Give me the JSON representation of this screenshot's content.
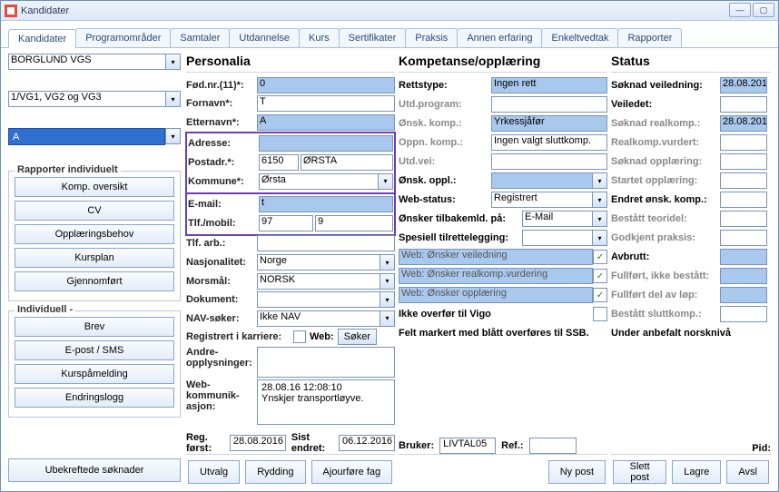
{
  "window": {
    "title": "Kandidater"
  },
  "tabs": [
    "Kandidater",
    "Programområder",
    "Samtaler",
    "Utdannelse",
    "Kurs",
    "Sertifikater",
    "Praksis",
    "Annen erfaring",
    "Enkeltvedtak",
    "Rapporter"
  ],
  "active_tab": 0,
  "left": {
    "school": "BORGLUND VGS",
    "level": "1/VG1, VG2 og VG3",
    "selected_row": "A",
    "group1_title": "Rapporter individuelt",
    "group1_btns": [
      "Komp. oversikt",
      "CV",
      "Opplæringsbehov",
      "Kursplan",
      "Gjennomført"
    ],
    "group2_title": "Individuell -",
    "group2_btns": [
      "Brev",
      "E-post / SMS",
      "Kurspåmelding",
      "Endringslogg"
    ],
    "ubekreftede": "Ubekreftede søknader"
  },
  "personalia": {
    "header": "Personalia",
    "fod_lbl": "Fød.nr.(11)*:",
    "fod_val": "0",
    "fornavn_lbl": "Fornavn*:",
    "fornavn_val": "T",
    "etternavn_lbl": "Etternavn*:",
    "etternavn_val": "A",
    "adresse_lbl": "Adresse:",
    "adresse_val": "",
    "postadr_lbl": "Postadr.*:",
    "postadr_nr": "6150",
    "postadr_sted": "ØRSTA",
    "kommune_lbl": "Kommune*:",
    "kommune_val": "Ørsta",
    "email_lbl": "E-mail:",
    "email_val": "t",
    "tlf_lbl": "Tlf./mobil:",
    "tlf1": "97",
    "tlf2": "9",
    "tlfarb_lbl": "Tlf. arb.:",
    "tlfarb_val": "",
    "nasj_lbl": "Nasjonalitet:",
    "nasj_val": "Norge",
    "morsmal_lbl": "Morsmål:",
    "morsmal_val": "NORSK",
    "dokument_lbl": "Dokument:",
    "dokument_val": "",
    "nav_lbl": "NAV-søker:",
    "nav_val": "Ikke NAV",
    "reg_lbl": "Registrert i karriere:",
    "web_lbl": "Web:",
    "web_btn": "Søker",
    "andre_lbl": "Andre-\nopplysninger:",
    "webkom_lbl": "Web-\nkommunik-\nasjon:",
    "webkom_txt": "28.08.16 12:08:10\nYnskjer transportløyve."
  },
  "kompetanse": {
    "header": "Kompetanse/opplæring",
    "rows": [
      {
        "lbl": "Rettstype:",
        "val": "Ingen rett",
        "sel": true,
        "gray": false
      },
      {
        "lbl": "Utd.program:",
        "val": "",
        "sel": false,
        "gray": true
      },
      {
        "lbl": "Ønsk. komp.:",
        "val": "Yrkessjåfør",
        "sel": true,
        "gray": true
      },
      {
        "lbl": "Oppn. komp.:",
        "val": "Ingen valgt sluttkomp.",
        "sel": false,
        "gray": true
      },
      {
        "lbl": "Utd.vei:",
        "val": "",
        "sel": false,
        "gray": true
      },
      {
        "lbl": "Ønsk. oppl.:",
        "val": "",
        "sel": true,
        "dd": true,
        "gray": false
      },
      {
        "lbl": "Web-status:",
        "val": "Registrert",
        "sel": false,
        "dd": true,
        "gray": false
      },
      {
        "lbl": "Ønsker tilbakemld. på:",
        "val": "E-Mail",
        "sel": false,
        "dd": true,
        "wide": true,
        "gray": false
      },
      {
        "lbl": "Spesiell tilrettelegging:",
        "val": "",
        "sel": false,
        "dd": true,
        "wide": true,
        "gray": false
      }
    ],
    "web_checks": [
      {
        "lbl": "Web: Ønsker veiledning",
        "checked": true
      },
      {
        "lbl": "Web: Ønsker realkomp.vurdering",
        "checked": true
      },
      {
        "lbl": "Web: Ønsker opplæring",
        "checked": true
      }
    ],
    "ikke_overfor": {
      "lbl": "Ikke overfør til Vigo",
      "checked": false
    },
    "felt_txt": "Felt markert med blått overføres til SSB."
  },
  "status": {
    "header": "Status",
    "rows": [
      {
        "lbl": "Søknad veiledning:",
        "val": "28.08.201",
        "sel": true
      },
      {
        "lbl": "Veiledet:",
        "val": "",
        "sel": false
      },
      {
        "lbl": "Søknad realkomp.:",
        "val": "28.08.201",
        "sel": true,
        "gray": true
      },
      {
        "lbl": "Realkomp.vurdert:",
        "val": "",
        "sel": false,
        "gray": true
      },
      {
        "lbl": "Søknad opplæring:",
        "val": "",
        "sel": false,
        "gray": true
      },
      {
        "lbl": "Startet opplæring:",
        "val": "",
        "sel": false,
        "gray": true
      },
      {
        "lbl": "Endret ønsk. komp.:",
        "val": "",
        "sel": false
      },
      {
        "lbl": "Bestått teoridel:",
        "val": "",
        "sel": false,
        "gray": true
      },
      {
        "lbl": "Godkjent praksis:",
        "val": "",
        "sel": false,
        "gray": true
      },
      {
        "lbl": "Avbrutt:",
        "val": "",
        "sel": true
      },
      {
        "lbl": "Fullført, ikke bestått:",
        "val": "",
        "sel": true,
        "gray": true
      },
      {
        "lbl": "Fullført del av løp:",
        "val": "",
        "sel": true,
        "gray": true
      },
      {
        "lbl": "Bestått sluttkomp.:",
        "val": "",
        "sel": false,
        "gray": true
      }
    ],
    "under_norsk": "Under anbefalt norsknivå"
  },
  "regline": {
    "regforst_lbl": "Reg. først:",
    "regforst_val": "28.08.2016",
    "sistendret_lbl": "Sist endret:",
    "sistendret_val": "06.12.2016",
    "bruker_lbl": "Bruker:",
    "bruker_val": "LIVTAL05",
    "ref_lbl": "Ref.:",
    "ref_val": "",
    "pid_lbl": "Pid:"
  },
  "footer": {
    "btns": [
      "Utvalg",
      "Rydding",
      "Ajourføre fag"
    ],
    "right_btns": [
      "Ny post",
      "Slett post",
      "Lagre",
      "Avsl"
    ]
  }
}
